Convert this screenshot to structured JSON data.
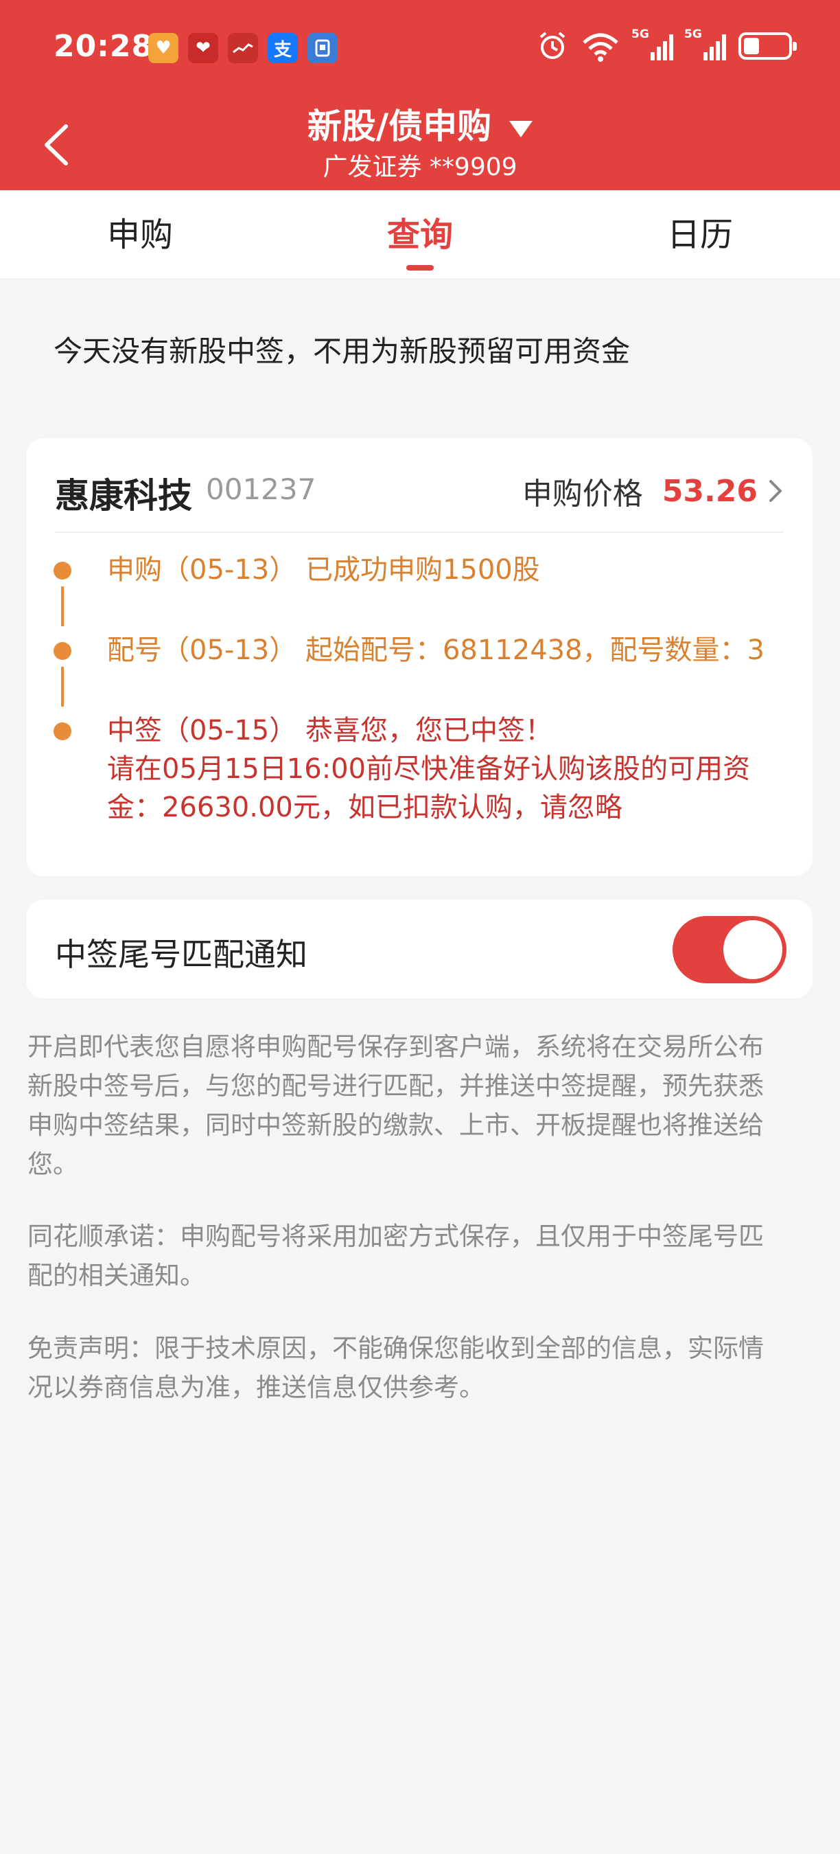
{
  "status_bar": {
    "time": "20:28",
    "signal_1_label": "5G",
    "signal_2_label": "5G",
    "apps": [
      {
        "icon": "taobao-heart-icon",
        "color": "#f5a33b"
      },
      {
        "icon": "health-app-icon",
        "color": "#c92a2a"
      },
      {
        "icon": "stock-app-icon",
        "color": "#c9302c"
      },
      {
        "icon": "alipay-icon",
        "color": "#1677ff",
        "glyph": "支"
      },
      {
        "icon": "security-app-icon",
        "color": "#3a7bd5"
      }
    ]
  },
  "header": {
    "title": "新股/债申购",
    "subtitle": "广发证券 **9909"
  },
  "tabs": [
    {
      "label": "申购",
      "active": false
    },
    {
      "label": "查询",
      "active": true
    },
    {
      "label": "日历",
      "active": false
    }
  ],
  "notice": "今天没有新股中签，不用为新股预留可用资金",
  "stock": {
    "name": "惠康科技",
    "code": "001237",
    "price_label": "申购价格",
    "price": "53.26",
    "timeline": [
      {
        "text": "申购（05-13） 已成功申购1500股",
        "color": "orange"
      },
      {
        "text": "配号（05-13） 起始配号：68112438，配号数量：3",
        "color": "orange"
      },
      {
        "line1": "中签（05-15） 恭喜您，您已中签！",
        "line2": "请在05月15日16:00前尽快准备好认购该股的可用资",
        "line3": "金：26630.00元，如已扣款认购，请忽略",
        "color": "red"
      }
    ]
  },
  "notify": {
    "label": "中签尾号匹配通知",
    "enabled": true
  },
  "disclaimers": {
    "p1": [
      "开启即代表您自愿将申购配号保存到客户端，系统将在交易所公布",
      "新股中签号后，与您的配号进行匹配，并推送中签提醒，预先获悉",
      "申购中签结果，同时中签新股的缴款、上市、开板提醒也将推送给",
      "您。"
    ],
    "p2": [
      "同花顺承诺：申购配号将采用加密方式保存，且仅用于中签尾号匹",
      "配的相关通知。"
    ],
    "p3": [
      "免责声明：限于技术原因，不能确保您能收到全部的信息，实际情",
      "况以券商信息为准，推送信息仅供参考。"
    ]
  },
  "colors": {
    "brand_red": "#e2413d",
    "timeline_orange": "#d9812f",
    "timeline_red": "#c6342f"
  }
}
